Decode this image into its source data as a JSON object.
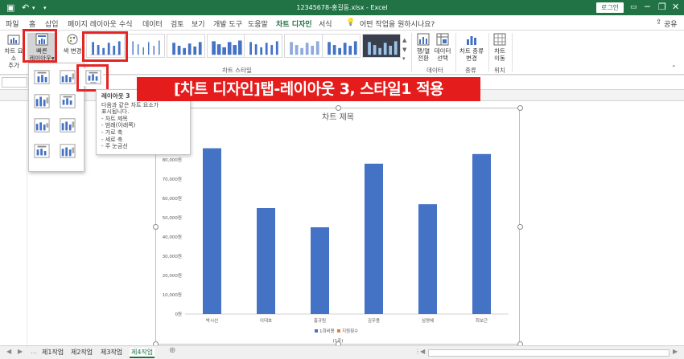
{
  "window": {
    "title": "12345678-홍길동.xlsx - Excel",
    "login_label": "로그인",
    "undo_glyph": "↶",
    "save_glyph": "▣",
    "minimize_glyph": "─",
    "restore_glyph": "❐",
    "close_glyph": "✕"
  },
  "tabs": [
    "파일",
    "홈",
    "삽입",
    "페이지 레이아웃",
    "수식",
    "데이터",
    "검토",
    "보기",
    "개발 도구",
    "도움말",
    "차트 디자인",
    "서식"
  ],
  "active_tab": "차트 디자인",
  "tell_me": "어떤 작업을 원하시나요?",
  "share": "공유",
  "ribbon": {
    "add_element": [
      "차트 요소",
      "추가"
    ],
    "quick_layout": [
      "빠른",
      "레이아웃"
    ],
    "change_color": [
      "색 변경"
    ],
    "chart_styles_label": "차트 스타일",
    "switch_row_col": [
      "행/열",
      "전환"
    ],
    "select_data": [
      "데이터",
      "선택"
    ],
    "data_label": "데이터",
    "change_type": [
      "차트 종류",
      "변경"
    ],
    "type_label": "종류",
    "move_chart": [
      "차트",
      "이동"
    ],
    "location_label": "위치"
  },
  "banner": "[차트 디자인]탭-레이아웃 3, 스타일1 적용",
  "tooltip": {
    "title": "레이아웃 3",
    "lines": [
      "다음과 같은 차트 요소가",
      "표시됩니다.",
      "- 차트 제목",
      "- 범례(아래쪽)",
      "- 가로 축",
      "- 세로 축",
      "- 주 눈금선"
    ]
  },
  "sheet_tabs": [
    "제1작업",
    "제2작업",
    "제3작업",
    "제4작업"
  ],
  "active_sheet": "제4작업",
  "add_sheet": "⊕",
  "colors": {
    "excel_green": "#217346",
    "bar": "#4472c4",
    "highlight": "#e52525",
    "legend2": "#ed7d31"
  },
  "chart_data": {
    "type": "bar",
    "title": "차트 제목",
    "categories": [
      "박시선",
      "이대호",
      "홍규림",
      "김우용",
      "심명혜",
      "최보근"
    ],
    "series": [
      {
        "name": "1회비용",
        "values": [
          86000,
          55000,
          45000,
          78000,
          57000,
          83000
        ]
      },
      {
        "name": "지원횟수",
        "values": [
          0,
          0,
          0,
          0,
          0,
          0
        ]
      }
    ],
    "ylim": [
      0,
      90000
    ],
    "yticks": [
      "0원",
      "10,000원",
      "20,000원",
      "30,000원",
      "40,000원",
      "50,000원",
      "60,000원",
      "70,000원",
      "80,000원"
    ],
    "xlabel": "(1주)",
    "legend": "bottom",
    "grid": false
  }
}
